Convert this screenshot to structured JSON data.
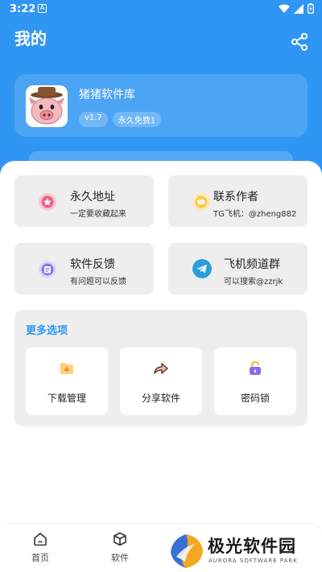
{
  "status_bar": {
    "time": "3:22",
    "notification_glyph": "A",
    "icons": [
      "wifi-icon",
      "signal-icon",
      "battery-icon"
    ]
  },
  "header": {
    "title": "我的",
    "share_icon": "share-icon"
  },
  "profile": {
    "name": "猪猪软件库",
    "version": "v1.7",
    "tag": "永久免费1"
  },
  "cards": [
    {
      "title": "永久地址",
      "subtitle": "一定要收藏起来",
      "icon": "star-icon"
    },
    {
      "title": "联系作者",
      "subtitle": "TG飞机：@zheng882",
      "icon": "chat-icon"
    },
    {
      "title": "软件反馈",
      "subtitle": "有问题可以反馈",
      "icon": "feedback-icon"
    },
    {
      "title": "飞机频道群",
      "subtitle": "可以搜索@zzrjk",
      "icon": "telegram-icon"
    }
  ],
  "more": {
    "title": "更多选项",
    "items": [
      {
        "label": "下载管理",
        "icon": "download-folder-icon"
      },
      {
        "label": "分享软件",
        "icon": "share-arrow-icon"
      },
      {
        "label": "密码锁",
        "icon": "lock-icon"
      }
    ]
  },
  "bottom_nav": [
    {
      "label": "首页",
      "icon": "home-icon"
    },
    {
      "label": "软件",
      "icon": "cube-icon"
    }
  ],
  "watermark": {
    "title": "极光软件园",
    "subtitle": "AURORA SOFTWARE PARK"
  },
  "colors": {
    "primary": "#2f96f3",
    "card_bg": "#eeeeee",
    "link": "#2f96f3"
  }
}
